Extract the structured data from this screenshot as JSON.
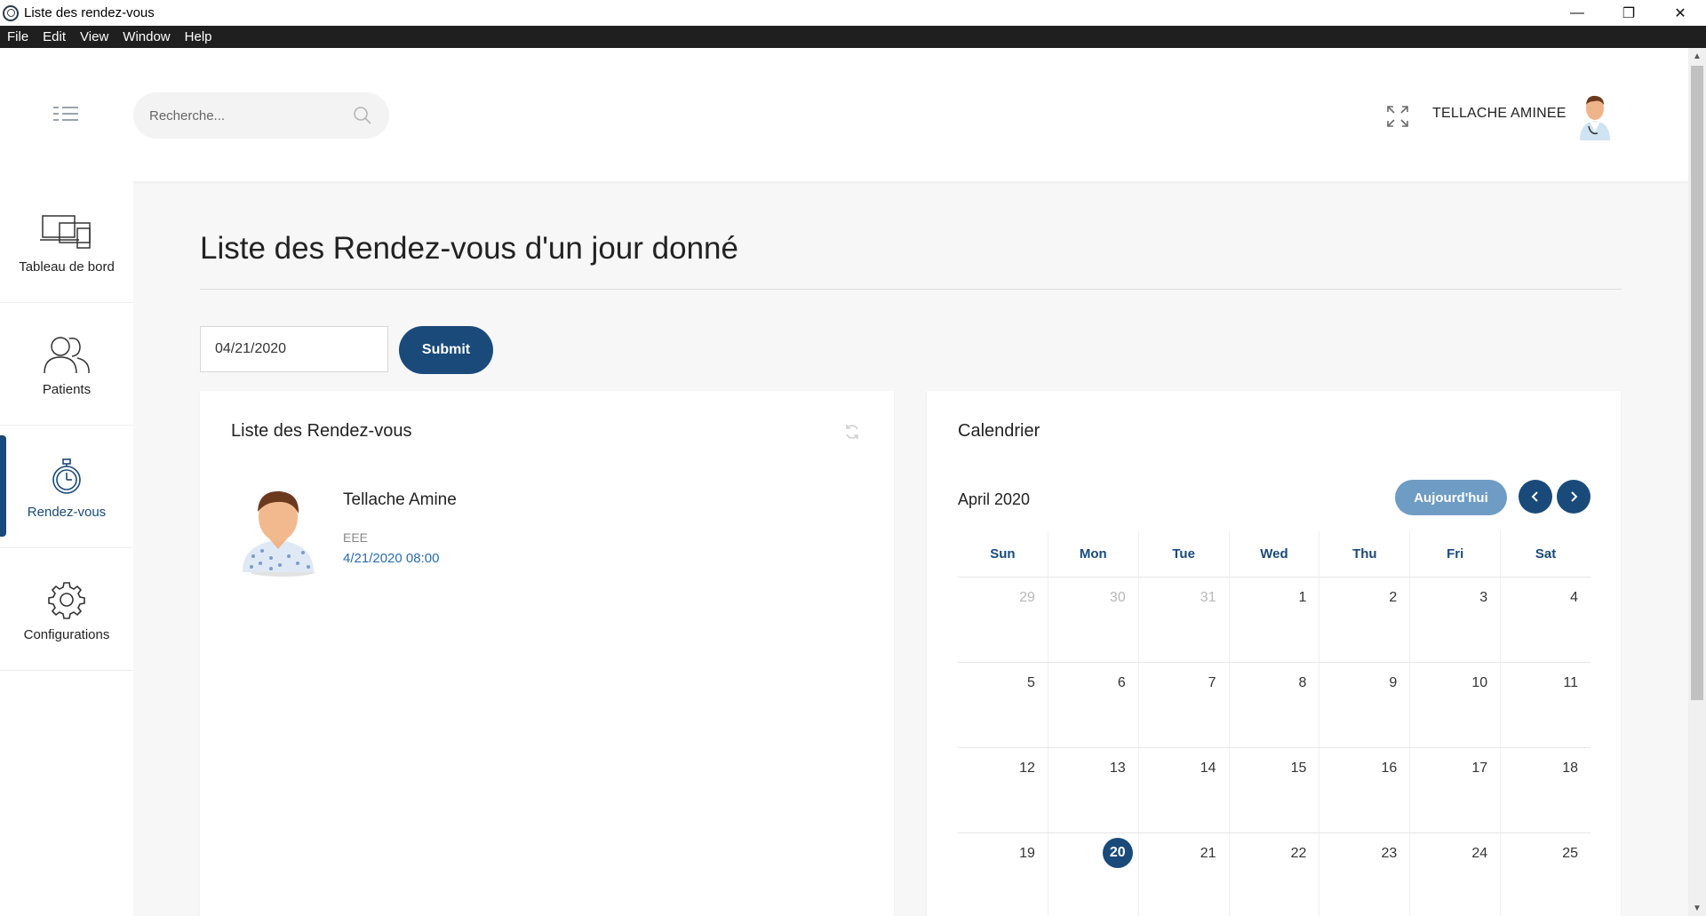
{
  "window": {
    "title": "Liste des rendez-vous",
    "minimize": "—",
    "restore": "❐",
    "close": "✕"
  },
  "menubar": [
    "File",
    "Edit",
    "View",
    "Window",
    "Help"
  ],
  "header": {
    "search_placeholder": "Recherche...",
    "username": "TELLACHE AMINEE"
  },
  "sidebar": [
    {
      "label": "Tableau de bord",
      "icon": "monitor-icon"
    },
    {
      "label": "Patients",
      "icon": "users-icon"
    },
    {
      "label": "Rendez-vous",
      "icon": "stopwatch-icon",
      "active": true
    },
    {
      "label": "Configurations",
      "icon": "gear-icon"
    }
  ],
  "page": {
    "title": "Liste des Rendez-vous d'un jour donné",
    "date_value": "04/21/2020",
    "submit_label": "Submit"
  },
  "appointments": {
    "title": "Liste des Rendez-vous",
    "items": [
      {
        "name": "Tellache Amine",
        "reason": "EEE",
        "datetime": "4/21/2020 08:00"
      }
    ]
  },
  "calendar": {
    "title": "Calendrier",
    "month": "April 2020",
    "today_label": "Aujourd'hui",
    "weekdays": [
      "Sun",
      "Mon",
      "Tue",
      "Wed",
      "Thu",
      "Fri",
      "Sat"
    ],
    "weeks": [
      [
        "29",
        "30",
        "31",
        "1",
        "2",
        "3",
        "4"
      ],
      [
        "5",
        "6",
        "7",
        "8",
        "9",
        "10",
        "11"
      ],
      [
        "12",
        "13",
        "14",
        "15",
        "16",
        "17",
        "18"
      ],
      [
        "19",
        "20",
        "21",
        "22",
        "23",
        "24",
        "25"
      ]
    ],
    "muted": [
      "29",
      "30",
      "31"
    ],
    "today": "20",
    "accent_color": "#1a4a7a"
  }
}
